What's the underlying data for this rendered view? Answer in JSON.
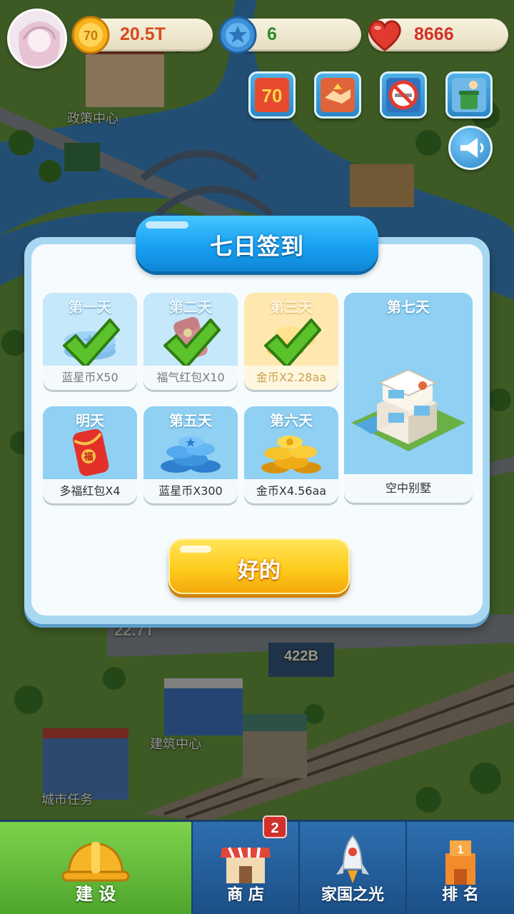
{
  "resources": {
    "gold": {
      "value": "20.5T",
      "icon": "gold-coin-icon",
      "icon_text": "70",
      "color": "#d74b1c"
    },
    "star": {
      "value": "6",
      "icon": "blue-star-coin-icon",
      "color": "#2f8a2a"
    },
    "heart": {
      "value": "8666",
      "icon": "heart-icon",
      "color": "#d23226"
    }
  },
  "top_buttons": [
    {
      "name": "anniversary-70-button",
      "icon_text": "70"
    },
    {
      "name": "handshake-button",
      "icon": "handshake-icon"
    },
    {
      "name": "no-smoking-button",
      "icon": "no-smoking-icon"
    },
    {
      "name": "recycle-button",
      "icon": "recycle-icon"
    }
  ],
  "map_labels": {
    "policy_center": "政策中心",
    "building_center": "建筑中心",
    "city_tasks": "城市任务",
    "billboard": "422B",
    "faded_number": "22.7T"
  },
  "dialog": {
    "title": "七日签到",
    "ok_label": "好的",
    "cards": [
      {
        "day": "第一天",
        "reward": "蓝星币X50",
        "state": "claimed",
        "icon": "blue-star-coin-icon"
      },
      {
        "day": "第二天",
        "reward": "福气红包X10",
        "state": "claimed",
        "icon": "red-envelope-icon"
      },
      {
        "day": "第三天",
        "reward": "金币X2.28aa",
        "state": "claimed-today",
        "icon": "gold-coins-icon"
      },
      {
        "day": "明天",
        "reward": "多福红包X4",
        "state": "upcoming",
        "icon": "fu-red-envelope-icon",
        "fu_char": "福"
      },
      {
        "day": "第五天",
        "reward": "蓝星币X300",
        "state": "upcoming",
        "icon": "blue-star-coin-pile-icon"
      },
      {
        "day": "第六天",
        "reward": "金币X4.56aa",
        "state": "upcoming",
        "icon": "gold-coin-pile-icon"
      },
      {
        "day": "第七天",
        "reward": "空中别墅",
        "state": "upcoming",
        "icon": "villa-icon"
      }
    ]
  },
  "bottom_nav": {
    "tabs": [
      {
        "label": "建 设",
        "icon": "hard-hat-icon",
        "active": true
      },
      {
        "label": "商 店",
        "icon": "shop-icon",
        "active": false,
        "badge": "2"
      },
      {
        "label": "家国之光",
        "icon": "rocket-icon",
        "active": false
      },
      {
        "label": "排 名",
        "icon": "ranking-tower-icon",
        "active": false
      }
    ]
  },
  "colors": {
    "dialog_title_blue": "#18a0f2",
    "ok_button_yellow": "#ffcc1d",
    "card_blue": "#8fd0f3",
    "card_current": "#ffe8b0",
    "check_green": "#5cc22c",
    "nav_blue": "#2d6fb0",
    "nav_active_green": "#7ed24b"
  }
}
